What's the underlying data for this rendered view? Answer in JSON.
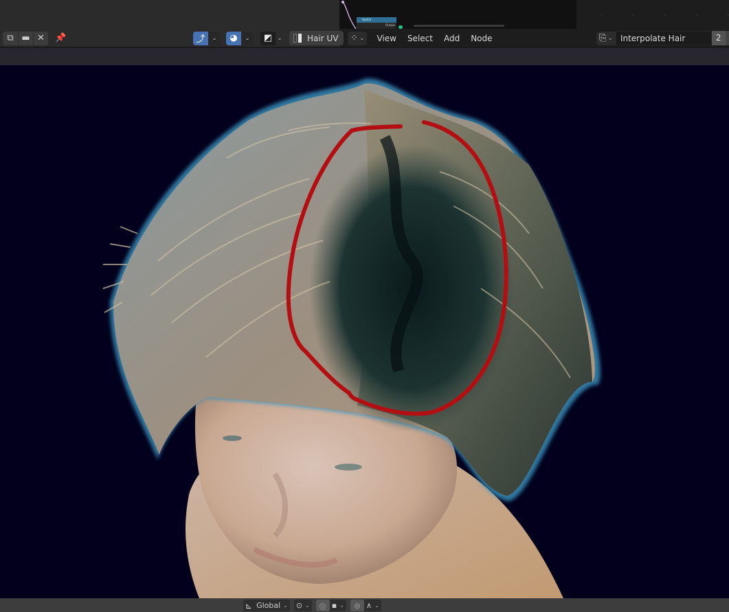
{
  "left_header": {
    "buttons": [
      {
        "icon": "duplicate-icon",
        "glyph": "⧉"
      },
      {
        "icon": "folder-icon",
        "glyph": "▬"
      },
      {
        "icon": "close-icon",
        "glyph": "✕"
      }
    ],
    "pin_icon": "pin-icon",
    "pin_glyph": "📌",
    "uv_sync_glyph": "⤴",
    "shading_glyph": "◕",
    "image_glyph": "◩",
    "dropdown_glyph": "⌄",
    "uv_map_label": "Hair UV"
  },
  "node_preview": {
    "node_title": "Switch",
    "node_output": "Output"
  },
  "node_header": {
    "editor_type_glyph": "⁘",
    "dropdown_glyph": "⌄",
    "menus": [
      "View",
      "Select",
      "Add",
      "Node"
    ],
    "node_tree_type_glyph": "⎘",
    "node_group_name": "Interpolate Hair Curves",
    "node_group_users": "2"
  },
  "viewport": {
    "background": "#02001c",
    "annotation_color": "#b30f12",
    "annotation_shape": "red-ellipse-around-hair-part",
    "subject": "3D head with hair curves viewed from above"
  },
  "bottom_header": {
    "orientation_glyph": "⊾",
    "orientation_label": "Global",
    "dropdown_glyph": "⌄",
    "pivot_glyph": "⊙",
    "snap_glyph": "◎",
    "snap_target_glyph": "▪",
    "proportional_glyph": "⊚",
    "falloff_glyph": "∧"
  }
}
